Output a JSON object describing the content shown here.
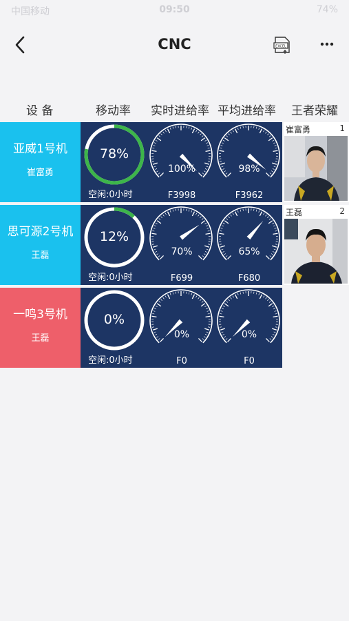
{
  "status": {
    "carrier": "中国移动",
    "time": "09:50",
    "battery": "74%"
  },
  "nav": {
    "title": "CNC"
  },
  "headers": {
    "device": "设 备",
    "utilization": "移动率",
    "realtime_feed": "实时进给率",
    "avg_feed": "平均进给率",
    "honor": "王者荣耀"
  },
  "machines": [
    {
      "name": "亚威1号机",
      "operator": "崔富勇",
      "utilization": "78%",
      "utilization_value": 0.78,
      "idle": "空闲:0小时",
      "realtime_pct": "100%",
      "realtime_value": 1.0,
      "realtime_feed": "F3998",
      "avg_pct": "98%",
      "avg_value": 0.98,
      "avg_feed": "F3962",
      "label_color": "#1ac1ee"
    },
    {
      "name": "思可源2号机",
      "operator": "王磊",
      "utilization": "12%",
      "utilization_value": 0.12,
      "idle": "空闲:0小时",
      "realtime_pct": "70%",
      "realtime_value": 0.7,
      "realtime_feed": "F699",
      "avg_pct": "65%",
      "avg_value": 0.65,
      "avg_feed": "F680",
      "label_color": "#1ac1ee"
    },
    {
      "name": "一鸣3号机",
      "operator": "王磊",
      "utilization": "0%",
      "utilization_value": 0.0,
      "idle": "空闲:0小时",
      "realtime_pct": "0%",
      "realtime_value": 0.0,
      "realtime_feed": "F0",
      "avg_pct": "0%",
      "avg_value": 0.0,
      "avg_feed": "F0",
      "label_color": "#ee5f6a"
    }
  ],
  "honor": [
    {
      "name": "崔富勇",
      "rank": "1"
    },
    {
      "name": "王磊",
      "rank": "2"
    }
  ],
  "colors": {
    "panel": "#1d3564",
    "progress": "#3db54a",
    "cyan": "#1ac1ee",
    "red": "#ee5f6a"
  }
}
